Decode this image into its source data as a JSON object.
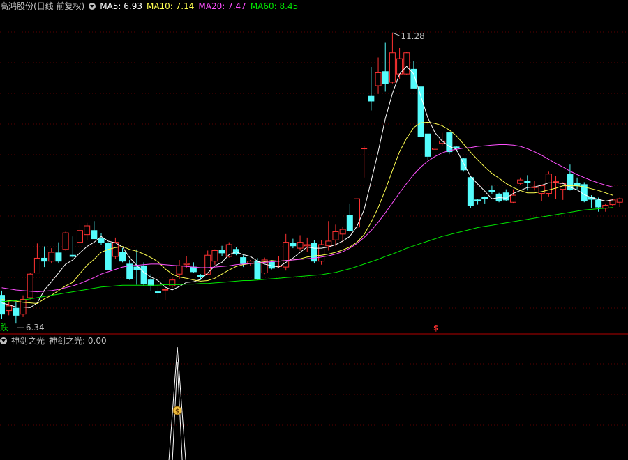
{
  "header": {
    "title": "高鸿股份(日线 前复权)",
    "ma5": "MA5: 6.93",
    "ma10": "MA10: 7.14",
    "ma20": "MA20: 7.47",
    "ma60": "MA60: 8.45"
  },
  "lower_header": {
    "title": "神剑之光",
    "value": "神剑之光: 0.00"
  },
  "colors": {
    "up": "#ff3232",
    "down": "#54fcfc",
    "ma5": "#ffffff",
    "ma10": "#ffff50",
    "ma20": "#ff50ff",
    "ma60": "#00e600",
    "grid": "#5a0000",
    "divider": "#b40000",
    "text": "#c0c0c0"
  },
  "markers": {
    "high_label": "11.28",
    "low_label": "6.34",
    "signal_glyph": "$",
    "corner_glyph": "跌",
    "bag_glyph": "$"
  },
  "chart_data": [
    {
      "type": "candlestick",
      "title": "高鸿股份(日线 前复权)",
      "ylim": [
        6.2,
        11.6
      ],
      "ohlc": [
        [
          6.82,
          6.9,
          6.42,
          6.5
        ],
        [
          6.56,
          6.72,
          6.48,
          6.64
        ],
        [
          6.6,
          6.7,
          6.34,
          6.48
        ],
        [
          6.5,
          6.82,
          6.45,
          6.75
        ],
        [
          6.78,
          7.2,
          6.75,
          7.18
        ],
        [
          7.2,
          7.7,
          7.2,
          7.45
        ],
        [
          7.45,
          7.65,
          7.3,
          7.4
        ],
        [
          7.4,
          7.62,
          7.36,
          7.55
        ],
        [
          7.54,
          7.72,
          7.36,
          7.4
        ],
        [
          7.6,
          7.9,
          7.58,
          7.88
        ],
        [
          7.5,
          7.82,
          7.46,
          7.48
        ],
        [
          7.72,
          8.04,
          7.58,
          7.92
        ],
        [
          7.85,
          8.05,
          7.75,
          8.0
        ],
        [
          7.92,
          8.08,
          7.8,
          7.78
        ],
        [
          7.78,
          7.88,
          7.68,
          7.72
        ],
        [
          7.7,
          7.72,
          7.26,
          7.26
        ],
        [
          7.48,
          7.8,
          7.44,
          7.72
        ],
        [
          7.55,
          7.62,
          7.38,
          7.4
        ],
        [
          7.35,
          7.42,
          7.08,
          7.1
        ],
        [
          7.3,
          7.6,
          7.0,
          7.26
        ],
        [
          7.32,
          7.38,
          6.98,
          7.02
        ],
        [
          7.08,
          7.18,
          6.9,
          6.98
        ],
        [
          6.88,
          7.02,
          6.78,
          6.86
        ],
        [
          6.92,
          6.98,
          6.74,
          6.92
        ],
        [
          6.98,
          7.12,
          6.95,
          7.08
        ],
        [
          7.18,
          7.42,
          7.1,
          7.32
        ],
        [
          7.34,
          7.48,
          7.28,
          7.36
        ],
        [
          7.3,
          7.38,
          7.2,
          7.22
        ],
        [
          7.16,
          7.18,
          7.08,
          7.14
        ],
        [
          7.18,
          7.58,
          7.16,
          7.5
        ],
        [
          7.4,
          7.6,
          7.34,
          7.58
        ],
        [
          7.58,
          7.66,
          7.48,
          7.54
        ],
        [
          7.48,
          7.72,
          7.46,
          7.68
        ],
        [
          7.6,
          7.64,
          7.5,
          7.52
        ],
        [
          7.46,
          7.5,
          7.3,
          7.36
        ],
        [
          7.36,
          7.42,
          7.32,
          7.4
        ],
        [
          7.4,
          7.45,
          7.08,
          7.1
        ],
        [
          7.2,
          7.46,
          7.18,
          7.42
        ],
        [
          7.38,
          7.4,
          7.26,
          7.28
        ],
        [
          7.32,
          7.48,
          7.28,
          7.32
        ],
        [
          7.3,
          7.86,
          7.24,
          7.72
        ],
        [
          7.7,
          7.78,
          7.62,
          7.66
        ],
        [
          7.62,
          7.84,
          7.58,
          7.72
        ],
        [
          7.66,
          7.8,
          7.56,
          7.68
        ],
        [
          7.7,
          7.76,
          7.36,
          7.4
        ],
        [
          7.4,
          7.76,
          7.34,
          7.68
        ],
        [
          7.66,
          8.08,
          7.58,
          7.74
        ],
        [
          7.76,
          8.02,
          7.66,
          7.9
        ],
        [
          7.86,
          7.98,
          7.72,
          7.94
        ],
        [
          8.18,
          8.38,
          7.9,
          7.92
        ],
        [
          7.98,
          8.5,
          7.96,
          8.46
        ],
        [
          9.32,
          9.36,
          8.82,
          9.32
        ],
        [
          10.2,
          10.7,
          9.96,
          10.12
        ],
        [
          10.38,
          10.86,
          10.24,
          10.6
        ],
        [
          10.62,
          11.12,
          10.28,
          10.42
        ],
        [
          10.44,
          11.28,
          10.42,
          10.94
        ],
        [
          10.58,
          11.02,
          10.5,
          10.84
        ],
        [
          10.58,
          10.96,
          10.56,
          10.94
        ],
        [
          10.66,
          10.8,
          10.34,
          10.34
        ],
        [
          10.36,
          10.36,
          9.52,
          9.52
        ],
        [
          9.56,
          9.56,
          9.12,
          9.18
        ],
        [
          9.3,
          9.34,
          9.28,
          9.32
        ],
        [
          9.4,
          9.58,
          9.36,
          9.44
        ],
        [
          9.58,
          9.6,
          9.22,
          9.26
        ],
        [
          9.34,
          9.36,
          9.26,
          9.32
        ],
        [
          9.14,
          9.16,
          8.92,
          8.95
        ],
        [
          8.82,
          8.84,
          8.3,
          8.34
        ],
        [
          8.44,
          8.46,
          8.36,
          8.42
        ],
        [
          8.48,
          8.5,
          8.38,
          8.46
        ],
        [
          8.6,
          8.68,
          8.54,
          8.58
        ],
        [
          8.54,
          8.56,
          8.4,
          8.42
        ],
        [
          8.56,
          8.62,
          8.42,
          8.44
        ],
        [
          8.4,
          8.62,
          8.39,
          8.52
        ],
        [
          8.72,
          8.82,
          8.7,
          8.78
        ],
        [
          8.76,
          8.86,
          8.6,
          8.74
        ],
        [
          8.66,
          8.76,
          8.6,
          8.66
        ],
        [
          8.55,
          8.7,
          8.42,
          8.68
        ],
        [
          8.55,
          8.92,
          8.5,
          8.88
        ],
        [
          8.75,
          8.85,
          8.45,
          8.75
        ],
        [
          8.62,
          8.74,
          8.44,
          8.72
        ],
        [
          8.88,
          9.04,
          8.6,
          8.62
        ],
        [
          8.72,
          8.82,
          8.62,
          8.68
        ],
        [
          8.7,
          8.74,
          8.4,
          8.42
        ],
        [
          8.48,
          8.52,
          8.3,
          8.45
        ],
        [
          8.44,
          8.48,
          8.24,
          8.32
        ],
        [
          8.3,
          8.38,
          8.24,
          8.35
        ],
        [
          8.36,
          8.46,
          8.34,
          8.44
        ],
        [
          8.4,
          8.48,
          8.32,
          8.46
        ]
      ],
      "series": [
        {
          "name": "MA5",
          "values": [
            6.69,
            6.66,
            6.62,
            6.62,
            6.61,
            6.69,
            6.91,
            7.05,
            7.2,
            7.35,
            7.42,
            7.54,
            7.65,
            7.72,
            7.82,
            7.74,
            7.71,
            7.64,
            7.46,
            7.33,
            7.21,
            7.13,
            7.07,
            6.96,
            6.91,
            6.97,
            7.04,
            7.05,
            7.09,
            7.2,
            7.32,
            7.38,
            7.51,
            7.56,
            7.51,
            7.48,
            7.4,
            7.35,
            7.32,
            7.3,
            7.38,
            7.45,
            7.55,
            7.64,
            7.62,
            7.62,
            7.64,
            7.68,
            7.74,
            7.82,
            7.99,
            8.27,
            8.76,
            9.26,
            9.82,
            10.25,
            10.58,
            10.71,
            10.58,
            10.2,
            9.83,
            9.58,
            9.44,
            9.35,
            9.3,
            9.06,
            8.84,
            8.71,
            8.59,
            8.46,
            8.48,
            8.47,
            8.55,
            8.6,
            8.65,
            8.66,
            8.69,
            8.73,
            8.73,
            8.72,
            8.66,
            8.61,
            8.53,
            8.48,
            8.45,
            8.42,
            8.44
          ]
        },
        {
          "name": "MA10",
          "values": [
            6.75,
            6.73,
            6.72,
            6.7,
            6.69,
            6.68,
            6.76,
            6.82,
            6.9,
            6.98,
            7.04,
            7.19,
            7.33,
            7.43,
            7.55,
            7.6,
            7.63,
            7.65,
            7.6,
            7.57,
            7.52,
            7.46,
            7.39,
            7.27,
            7.18,
            7.13,
            7.11,
            7.08,
            7.06,
            7.07,
            7.11,
            7.18,
            7.25,
            7.31,
            7.34,
            7.36,
            7.37,
            7.39,
            7.41,
            7.4,
            7.41,
            7.42,
            7.44,
            7.47,
            7.49,
            7.5,
            7.52,
            7.55,
            7.59,
            7.64,
            7.72,
            7.85,
            8.06,
            8.31,
            8.61,
            8.94,
            9.26,
            9.49,
            9.67,
            9.75,
            9.76,
            9.74,
            9.7,
            9.63,
            9.53,
            9.39,
            9.25,
            9.12,
            9.0,
            8.89,
            8.81,
            8.72,
            8.65,
            8.6,
            8.56,
            8.56,
            8.58,
            8.61,
            8.64,
            8.68,
            8.68,
            8.68,
            8.66,
            8.63,
            8.6,
            8.56,
            8.52
          ]
        },
        {
          "name": "MA20",
          "values": [
            6.95,
            6.93,
            6.91,
            6.9,
            6.89,
            6.88,
            6.89,
            6.9,
            6.92,
            6.95,
            6.98,
            7.02,
            7.07,
            7.12,
            7.18,
            7.22,
            7.26,
            7.3,
            7.32,
            7.33,
            7.34,
            7.35,
            7.35,
            7.34,
            7.33,
            7.32,
            7.31,
            7.3,
            7.29,
            7.29,
            7.3,
            7.31,
            7.32,
            7.34,
            7.35,
            7.36,
            7.37,
            7.38,
            7.39,
            7.4,
            7.41,
            7.42,
            7.43,
            7.44,
            7.45,
            7.47,
            7.49,
            7.52,
            7.56,
            7.62,
            7.7,
            7.8,
            7.92,
            8.06,
            8.22,
            8.39,
            8.56,
            8.72,
            8.87,
            9.0,
            9.1,
            9.18,
            9.24,
            9.28,
            9.3,
            9.32,
            9.33,
            9.35,
            9.36,
            9.37,
            9.38,
            9.38,
            9.37,
            9.35,
            9.31,
            9.26,
            9.2,
            9.13,
            9.06,
            9.0,
            8.93,
            8.87,
            8.82,
            8.77,
            8.73,
            8.69,
            8.66
          ]
        },
        {
          "name": "MA60",
          "values": [
            6.71,
            6.72,
            6.73,
            6.74,
            6.76,
            6.78,
            6.8,
            6.82,
            6.84,
            6.86,
            6.88,
            6.9,
            6.92,
            6.94,
            6.96,
            6.97,
            6.98,
            6.99,
            6.99,
            6.99,
            6.99,
            6.99,
            6.99,
            7.0,
            7.0,
            7.0,
            7.01,
            7.01,
            7.02,
            7.02,
            7.03,
            7.04,
            7.05,
            7.06,
            7.07,
            7.07,
            7.08,
            7.09,
            7.1,
            7.11,
            7.12,
            7.13,
            7.14,
            7.15,
            7.16,
            7.17,
            7.19,
            7.21,
            7.24,
            7.27,
            7.31,
            7.35,
            7.39,
            7.43,
            7.48,
            7.52,
            7.57,
            7.62,
            7.66,
            7.7,
            7.74,
            7.78,
            7.82,
            7.85,
            7.88,
            7.91,
            7.94,
            7.97,
            7.99,
            8.01,
            8.03,
            8.05,
            8.07,
            8.09,
            8.11,
            8.13,
            8.15,
            8.17,
            8.19,
            8.21,
            8.23,
            8.25,
            8.27,
            8.28,
            8.29,
            8.3,
            8.31
          ]
        }
      ],
      "annotations": [
        {
          "text": "11.28",
          "candle_index": 55
        },
        {
          "text": "6.34",
          "candle_index": 2
        }
      ]
    },
    {
      "type": "line",
      "title": "神剑之光",
      "series": [
        {
          "name": "神剑之光",
          "value": 0.0
        }
      ],
      "signal_candle_index": 20
    }
  ]
}
